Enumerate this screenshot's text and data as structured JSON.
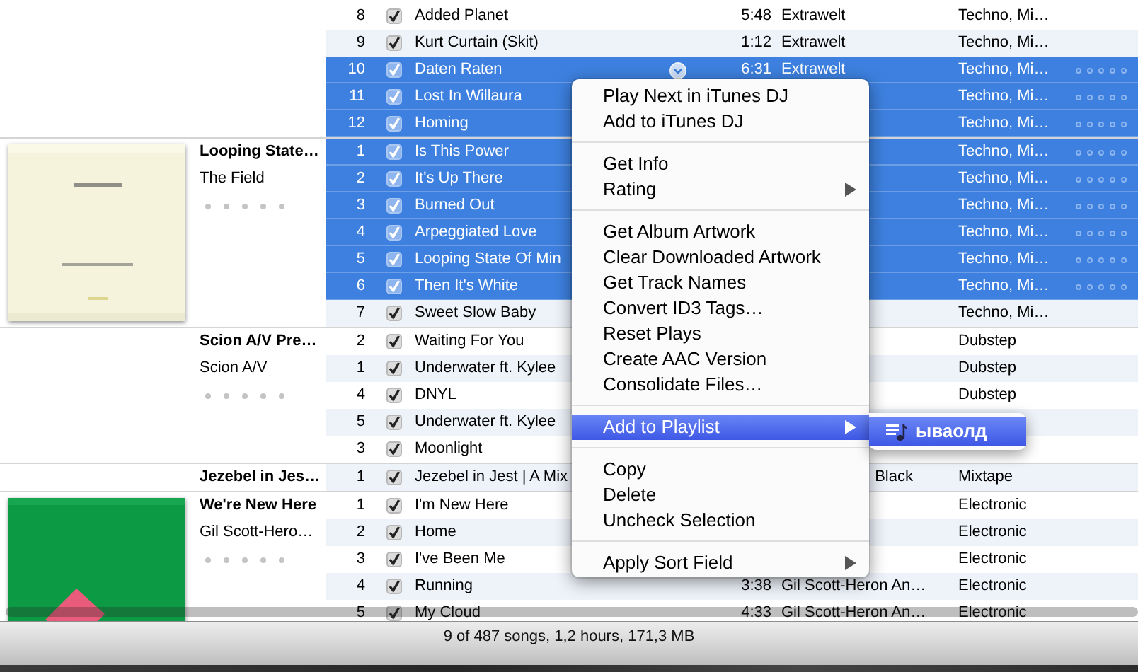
{
  "groups": [
    {
      "tracks": [
        {
          "number": "8",
          "checked": true,
          "name": "Added Planet",
          "time": "5:48",
          "artist": "Extrawelt",
          "genre": "Techno, Mi…",
          "selected": false
        },
        {
          "number": "9",
          "checked": true,
          "name": "Kurt Curtain (Skit)",
          "time": "1:12",
          "artist": "Extrawelt",
          "genre": "Techno, Mi…",
          "selected": false
        },
        {
          "number": "10",
          "checked": true,
          "name": "Daten Raten",
          "hover": true,
          "time": "6:31",
          "artist": "Extrawelt",
          "genre": "Techno, Mi…",
          "selected": true,
          "stars": 0
        },
        {
          "number": "11",
          "checked": true,
          "name": "Lost In Willaura",
          "genre": "Techno, Mi…",
          "selected": true,
          "stars": 0
        },
        {
          "number": "12",
          "checked": true,
          "name": "Homing",
          "genre": "Techno, Mi…",
          "selected": true,
          "stars": 0
        }
      ]
    },
    {
      "album": "Looping State…",
      "album_artist": "The Field",
      "stars": 0,
      "artwork": {
        "kind": "picture"
      },
      "tracks": [
        {
          "number": "1",
          "checked": true,
          "name": "Is This Power",
          "genre": "Techno, Mi…",
          "selected": true,
          "stars": 0
        },
        {
          "number": "2",
          "checked": true,
          "name": "It's Up There",
          "genre": "Techno, Mi…",
          "selected": true,
          "stars": 0
        },
        {
          "number": "3",
          "checked": true,
          "name": "Burned Out",
          "genre": "Techno, Mi…",
          "selected": true,
          "stars": 0
        },
        {
          "number": "4",
          "checked": true,
          "name": "Arpeggiated Love",
          "genre": "Techno, Mi…",
          "selected": true,
          "stars": 0
        },
        {
          "number": "5",
          "checked": true,
          "name": "Looping State Of Min",
          "genre": "Techno, Mi…",
          "selected": true,
          "stars": 0
        },
        {
          "number": "6",
          "checked": true,
          "name": "Then It's White",
          "genre": "Techno, Mi…",
          "selected": true,
          "stars": 0
        },
        {
          "number": "7",
          "checked": true,
          "name": "Sweet Slow Baby",
          "genre": "Techno, Mi…",
          "selected": false
        }
      ]
    },
    {
      "album": "Scion A/V Pre…",
      "album_artist": "Scion A/V",
      "stars": 0,
      "tracks": [
        {
          "number": "2",
          "checked": true,
          "name": "Waiting For You",
          "genre": "Dubstep",
          "selected": false
        },
        {
          "number": "1",
          "checked": true,
          "name": "Underwater ft. Kylee",
          "genre": "Dubstep",
          "selected": false
        },
        {
          "number": "4",
          "checked": true,
          "name": "DNYL",
          "genre": "Dubstep",
          "selected": false
        },
        {
          "number": "5",
          "checked": true,
          "name": "Underwater ft. Kylee",
          "selected": false
        },
        {
          "number": "3",
          "checked": true,
          "name": "Moonlight",
          "selected": false
        }
      ]
    },
    {
      "album": "Jezebel in Jes…",
      "tracks": [
        {
          "number": "1",
          "checked": true,
          "name": "Jezebel in Jest | A Mix",
          "artist": "Black",
          "artist_cut": true,
          "genre": "Mixtape",
          "selected": false
        }
      ]
    },
    {
      "album": "We're New Here",
      "album_artist": "Gil Scott-Hero…",
      "stars": 0,
      "artwork": {
        "kind": "picture"
      },
      "tracks": [
        {
          "number": "1",
          "checked": true,
          "name": "I'm New Here",
          "genre": "Electronic",
          "selected": false
        },
        {
          "number": "2",
          "checked": true,
          "name": "Home",
          "genre": "Electronic",
          "selected": false
        },
        {
          "number": "3",
          "checked": true,
          "name": "I've Been Me",
          "genre": "Electronic",
          "selected": false
        },
        {
          "number": "4",
          "checked": true,
          "name": "Running",
          "time": "3:38",
          "artist": "Gil Scott-Heron An…",
          "genre": "Electronic",
          "selected": false
        },
        {
          "number": "5",
          "checked": true,
          "name": "My Cloud",
          "time": "4:33",
          "artist": "Gil Scott-Heron An…",
          "genre": "Electronic",
          "selected": false
        }
      ]
    }
  ],
  "context_menu": {
    "sections": [
      [
        {
          "label": "Play Next in iTunes DJ",
          "selected": false
        },
        {
          "label": "Add to iTunes DJ",
          "selected": false
        }
      ],
      [
        {
          "label": "Get Info",
          "selected": false
        },
        {
          "label": "Rating",
          "submenu": true,
          "selected": false
        }
      ],
      [
        {
          "label": "Get Album Artwork",
          "selected": false
        },
        {
          "label": "Clear Downloaded Artwork",
          "selected": false
        },
        {
          "label": "Get Track Names",
          "selected": false
        },
        {
          "label": "Convert ID3 Tags…",
          "selected": false
        },
        {
          "label": "Reset Plays",
          "selected": false
        },
        {
          "label": "Create AAC Version",
          "selected": false
        },
        {
          "label": "Consolidate Files…",
          "selected": false
        }
      ],
      [
        {
          "label": "Add to Playlist",
          "submenu": true,
          "selected": true
        }
      ],
      [
        {
          "label": "Copy",
          "selected": false
        },
        {
          "label": "Delete",
          "selected": false
        },
        {
          "label": "Uncheck Selection",
          "selected": false
        }
      ],
      [
        {
          "label": "Apply Sort Field",
          "submenu": true,
          "selected": false
        }
      ]
    ]
  },
  "playlist_submenu": {
    "items": [
      {
        "label": "ываолд",
        "selected": true
      }
    ]
  },
  "status_bar": {
    "text": "9 of 487 songs, 1,2 hours, 171,3 MB"
  }
}
